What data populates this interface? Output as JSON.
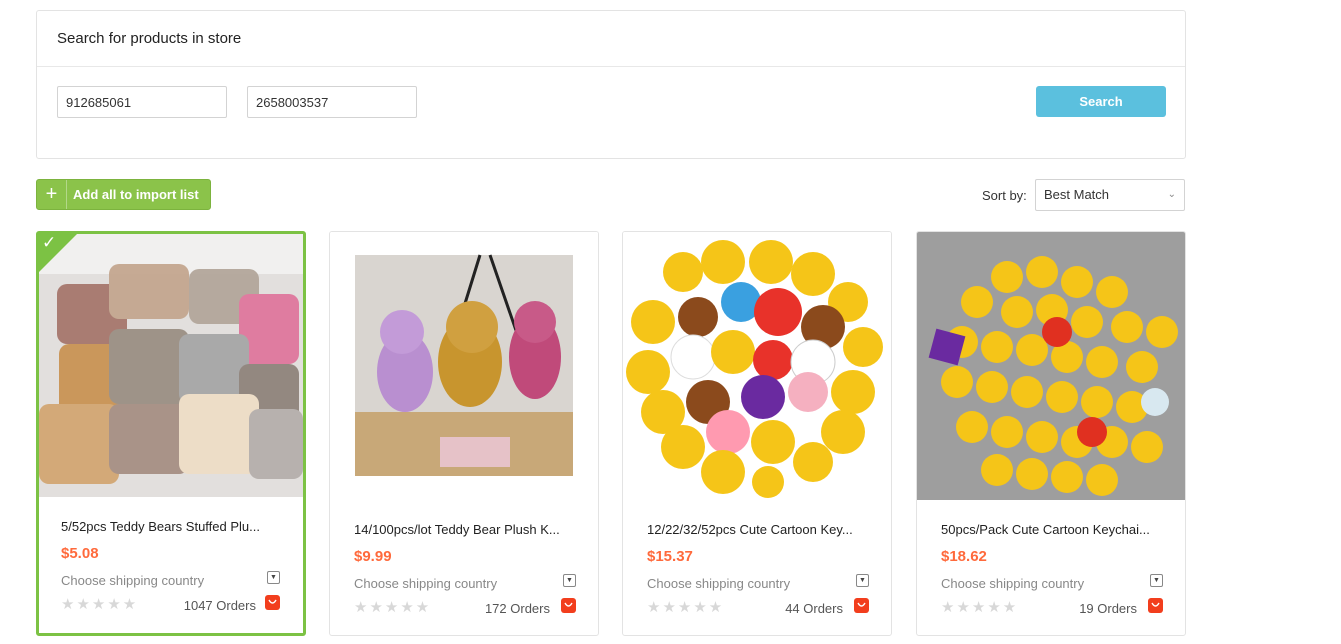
{
  "search_panel": {
    "title": "Search for products in store",
    "field_1_value": "912685061",
    "field_2_value": "2658003537",
    "search_label": "Search"
  },
  "toolbar": {
    "add_all_label": "Add all to import list",
    "sort_label": "Sort by:",
    "sort_value": "Best Match"
  },
  "products": [
    {
      "title": "5/52pcs Teddy Bears Stuffed Plu...",
      "price": "$5.08",
      "shipping": "Choose shipping country",
      "orders": "1047 Orders",
      "selected": true,
      "image": "teddy-bears-in-bags"
    },
    {
      "title": "14/100pcs/lot Teddy Bear Plush K...",
      "price": "$9.99",
      "shipping": "Choose shipping country",
      "orders": "172 Orders",
      "selected": false,
      "image": "three-teddy-bears"
    },
    {
      "title": "12/22/32/52pcs Cute Cartoon Key...",
      "price": "$15.37",
      "shipping": "Choose shipping country",
      "orders": "44 Orders",
      "selected": false,
      "image": "emoji-keychains-circle"
    },
    {
      "title": "50pcs/Pack Cute Cartoon Keychai...",
      "price": "$18.62",
      "shipping": "Choose shipping country",
      "orders": "19 Orders",
      "selected": false,
      "image": "emoji-keychains-pile"
    }
  ],
  "colors": {
    "accent_blue": "#5bc0de",
    "accent_green": "#8bc34a",
    "price_orange": "#ff6a3c",
    "aliexpress_red": "#f23e1d"
  }
}
